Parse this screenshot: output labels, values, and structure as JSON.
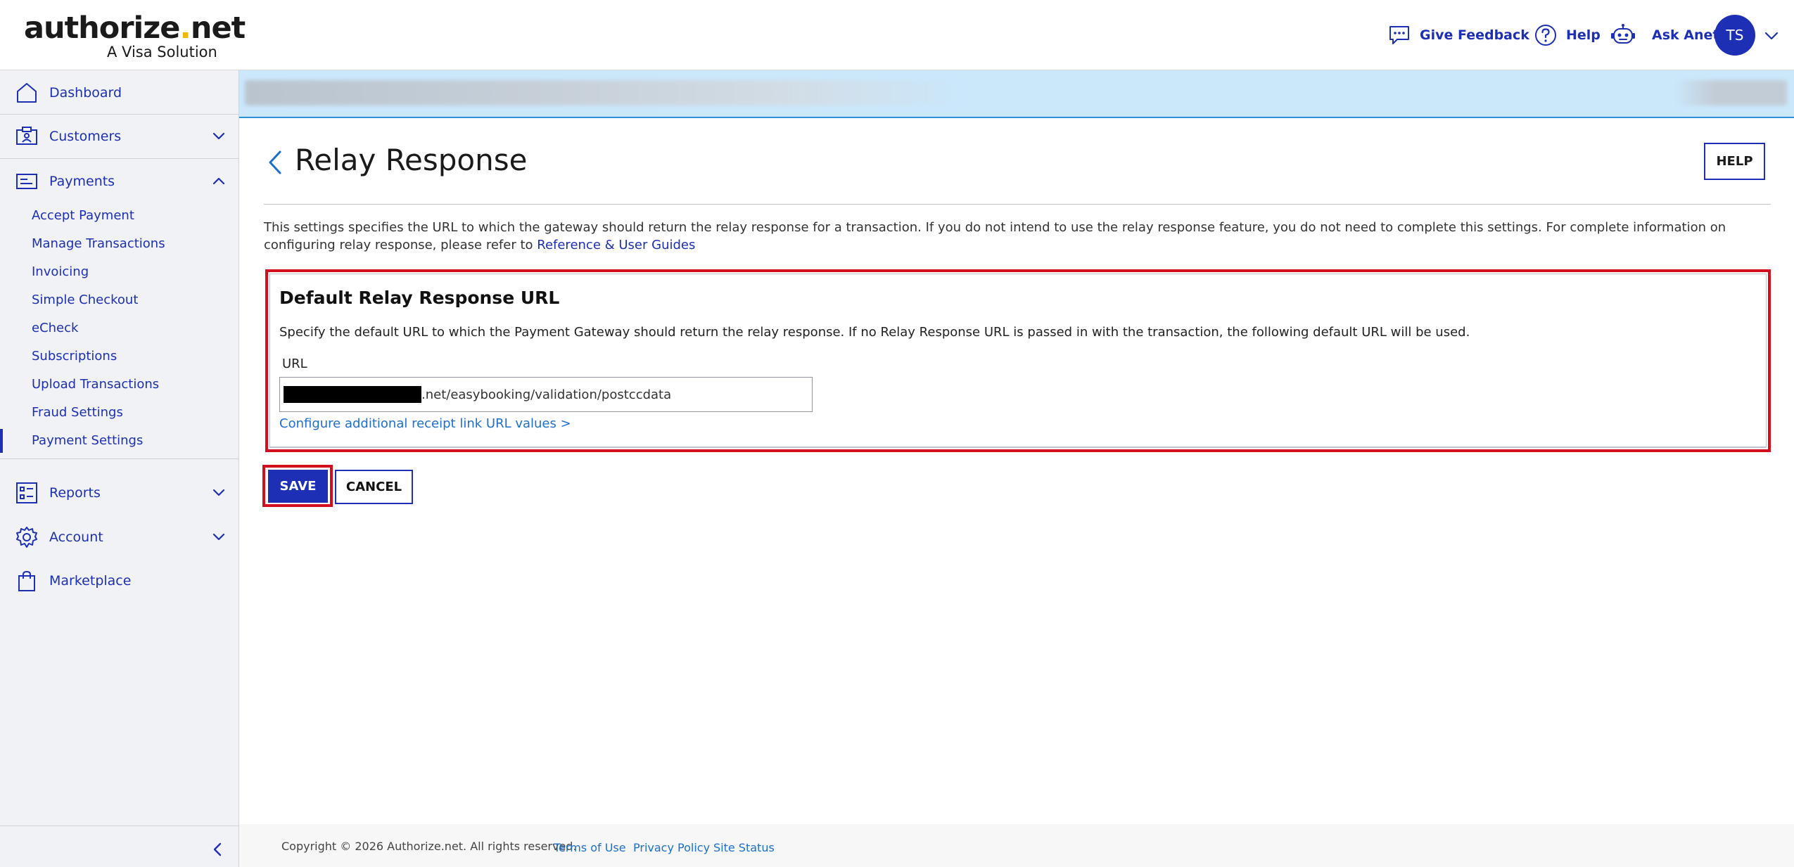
{
  "header": {
    "logo_text": "authorize",
    "logo_dot": ".",
    "logo_tld": "net",
    "logo_tagline": "A Visa Solution",
    "give_feedback_label": "Give Feedback",
    "help_label": "Help",
    "ask_anet_label": "Ask Anet",
    "avatar_initials": "TS"
  },
  "sidebar": {
    "dashboard": "Dashboard",
    "customers": "Customers",
    "payments": "Payments",
    "payments_items": [
      "Accept Payment",
      "Manage Transactions",
      "Invoicing",
      "Simple Checkout",
      "eCheck",
      "Subscriptions",
      "Upload Transactions",
      "Fraud Settings",
      "Payment Settings"
    ],
    "reports": "Reports",
    "account": "Account",
    "marketplace": "Marketplace"
  },
  "page": {
    "title": "Relay Response",
    "help_button": "HELP",
    "intro_text": "This settings specifies the URL to which the gateway should return the relay response for a transaction. If you do not intend to use the relay response feature, you do not need to complete this settings. For complete information on configuring relay response, please refer to ",
    "intro_link": "Reference & User Guides"
  },
  "relay_panel": {
    "title": "Default Relay Response URL",
    "description": "Specify the default URL to which the Payment Gateway should return the relay response. If no Relay Response URL is passed in with the transaction, the following default URL will be used.",
    "url_label": "URL",
    "url_value_visible": ".net/easybooking/validation/postccdata",
    "config_link": "Configure additional receipt link URL values >"
  },
  "actions": {
    "save": "SAVE",
    "cancel": "CANCEL"
  },
  "footer": {
    "copyright": "Copyright © 2026 Authorize.net. All rights reserved.",
    "links": [
      "Terms of Use",
      "Privacy Policy",
      "Site Status"
    ]
  },
  "colors": {
    "brand_blue": "#1c2fb5",
    "banner_bg": "#cbe8fb",
    "highlight_red": "#d20f1e",
    "logo_dot": "#f2b600"
  }
}
